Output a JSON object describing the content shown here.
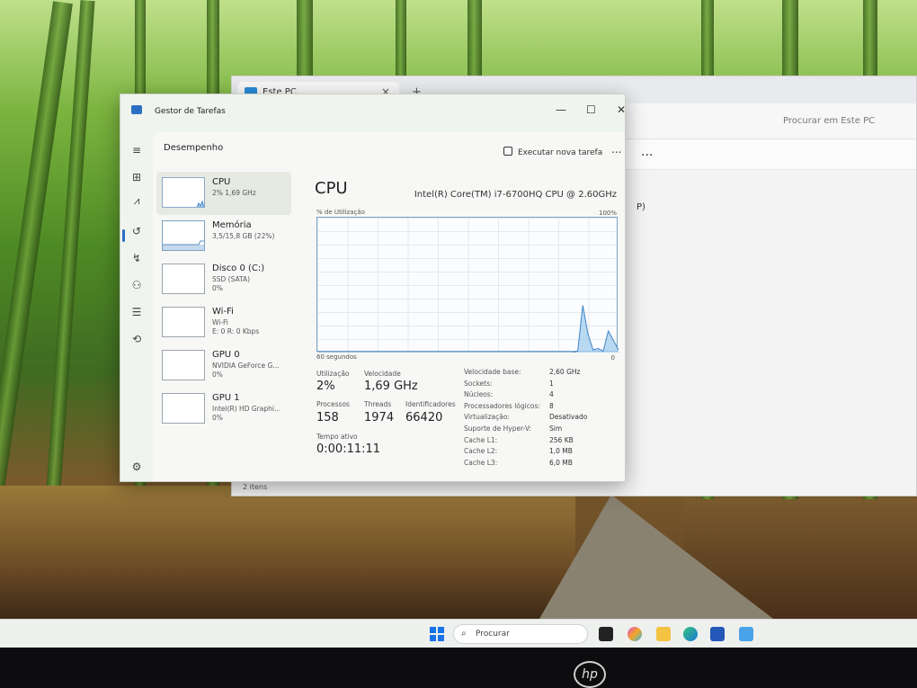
{
  "explorer": {
    "tab_title": "Este PC",
    "tab_close": "×",
    "new_tab": "+",
    "search_placeholder": "Procurar em Este PC",
    "more": "...",
    "fragment": "P)",
    "status": "2 itens"
  },
  "task_manager": {
    "window_title": "Gestor de Tarefas",
    "window_controls": {
      "minimize": "—",
      "maximize": "☐",
      "close": "✕"
    },
    "page_title": "Desempenho",
    "run_task_label": "Executar nova tarefa",
    "more": "...",
    "rail_icons": [
      "hamburger-icon",
      "processes-icon",
      "performance-icon",
      "history-icon",
      "startup-icon",
      "users-icon",
      "details-icon",
      "services-icon",
      "settings-icon"
    ],
    "sidebar": [
      {
        "name": "CPU",
        "sub": "2% 1,69 GHz",
        "sub2": ""
      },
      {
        "name": "Memória",
        "sub": "3,5/15,8 GB (22%)",
        "sub2": ""
      },
      {
        "name": "Disco 0 (C:)",
        "sub": "SSD (SATA)",
        "sub2": "0%"
      },
      {
        "name": "Wi-Fi",
        "sub": "Wi-Fi",
        "sub2": "E: 0 R: 0 Kbps"
      },
      {
        "name": "GPU 0",
        "sub": "NVIDIA GeForce G...",
        "sub2": "0%"
      },
      {
        "name": "GPU 1",
        "sub": "Intel(R) HD Graphi...",
        "sub2": "0%"
      }
    ],
    "detail": {
      "title": "CPU",
      "model": "Intel(R) Core(TM) i7-6700HQ CPU @ 2.60GHz",
      "graph_label_left": "% de Utilização",
      "graph_label_right": "100%",
      "graph_bottom_left": "60 segundos",
      "graph_bottom_right": "0",
      "stats": {
        "utilization_label": "Utilização",
        "utilization_value": "2%",
        "speed_label": "Velocidade",
        "speed_value": "1,69 GHz",
        "processes_label": "Processos",
        "processes_value": "158",
        "threads_label": "Threads",
        "threads_value": "1974",
        "handles_label": "Identificadores",
        "handles_value": "66420",
        "uptime_label": "Tempo ativo",
        "uptime_value": "0:00:11:11"
      },
      "specs": [
        {
          "key": "Velocidade base:",
          "value": "2,60 GHz"
        },
        {
          "key": "Sockets:",
          "value": "1"
        },
        {
          "key": "Núcleos:",
          "value": "4"
        },
        {
          "key": "Processadores lógicos:",
          "value": "8"
        },
        {
          "key": "Virtualização:",
          "value": "Desativado"
        },
        {
          "key": "Suporte de Hyper-V:",
          "value": "Sim"
        },
        {
          "key": "Cache L1:",
          "value": "256 KB"
        },
        {
          "key": "Cache L2:",
          "value": "1,0 MB"
        },
        {
          "key": "Cache L3:",
          "value": "6,0 MB"
        }
      ]
    },
    "cpu_history_percent": [
      0,
      0,
      0,
      0,
      0,
      0,
      0,
      0,
      0,
      0,
      0,
      0,
      0,
      0,
      0,
      0,
      0,
      0,
      0,
      0,
      0,
      0,
      0,
      0,
      0,
      0,
      0,
      0,
      0,
      0,
      0,
      0,
      0,
      0,
      0,
      0,
      0,
      0,
      0,
      0,
      0,
      0,
      0,
      0,
      0,
      0,
      0,
      0,
      0,
      0,
      0,
      1,
      35,
      14,
      2,
      3,
      1,
      16,
      9,
      2
    ]
  },
  "taskbar": {
    "search_label": "Procurar",
    "apps": [
      "task-view-icon",
      "copilot-icon",
      "file-explorer-icon",
      "edge-icon",
      "store-icon",
      "photos-icon"
    ]
  },
  "bezel": {
    "brand": "hp"
  },
  "colors": {
    "accent": "#2b6fc2",
    "graph_line": "#3f84c8",
    "graph_fill": "#a9cfee"
  }
}
